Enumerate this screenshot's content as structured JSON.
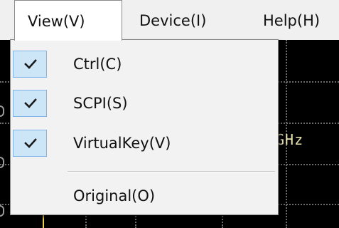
{
  "menubar": {
    "items": [
      {
        "label": "View(V)",
        "active": true
      },
      {
        "label": "Device(I)",
        "active": false
      },
      {
        "label": "Help(H)",
        "active": false
      }
    ]
  },
  "view_menu": {
    "items": [
      {
        "label": "Ctrl(C)",
        "checked": true
      },
      {
        "label": "SCPI(S)",
        "checked": true
      },
      {
        "label": "VirtualKey(V)",
        "checked": true
      },
      {
        "label": "Original(O)",
        "checked": false
      }
    ]
  },
  "display": {
    "frequency_label": "GHz",
    "trace_color": "#e6d34a",
    "grid_color": "#6b6b6b"
  },
  "colors": {
    "menu_background": "#f2f2f2",
    "check_highlight": "#cde6f7",
    "check_border": "#7eb4ea"
  }
}
